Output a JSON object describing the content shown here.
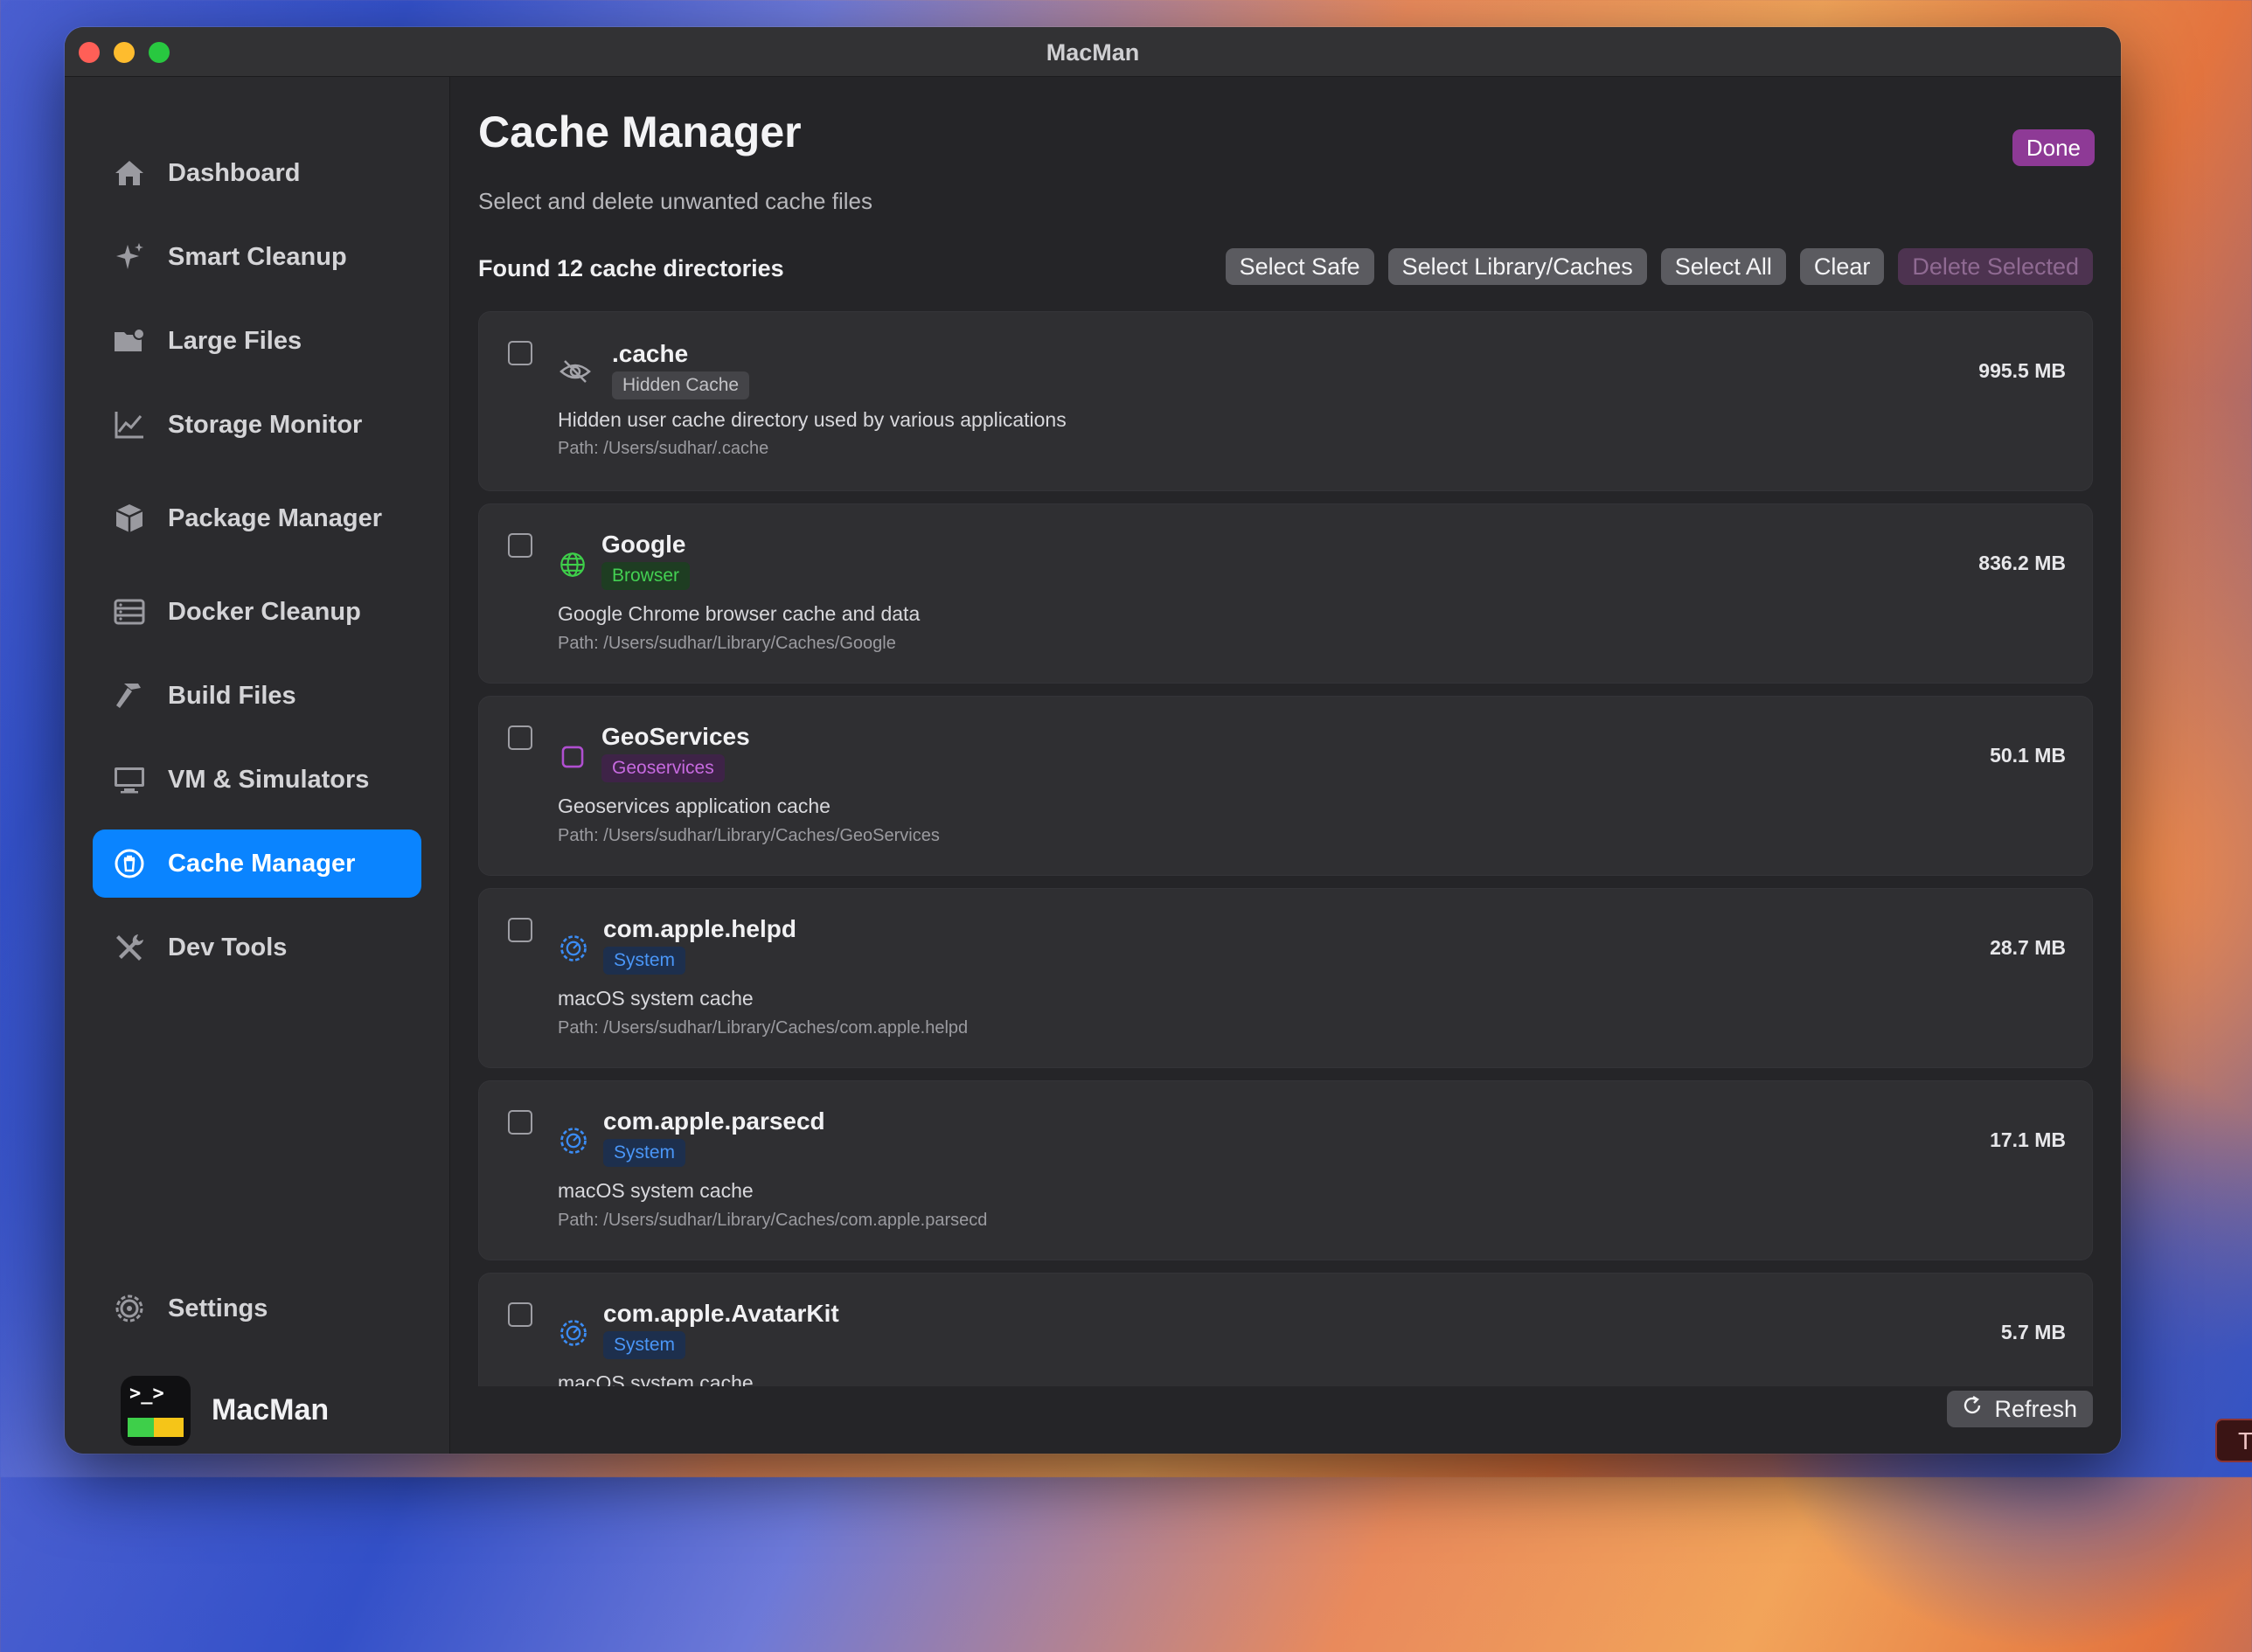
{
  "window": {
    "title": "MacMan"
  },
  "sidebar": {
    "items": [
      {
        "label": "Dashboard",
        "icon": "house-icon"
      },
      {
        "label": "Smart Cleanup",
        "icon": "sparkles-icon"
      },
      {
        "label": "Large Files",
        "icon": "folder-badge-icon"
      },
      {
        "label": "Storage Monitor",
        "icon": "line-chart-icon"
      },
      {
        "label": "Package Manager",
        "icon": "package-icon"
      },
      {
        "label": "Docker Cleanup",
        "icon": "server-rack-icon"
      },
      {
        "label": "Build Files",
        "icon": "hammer-icon"
      },
      {
        "label": "VM & Simulators",
        "icon": "monitor-icon"
      },
      {
        "label": "Cache Manager",
        "icon": "trash-circle-icon",
        "active": true
      },
      {
        "label": "Dev Tools",
        "icon": "tools-icon"
      }
    ],
    "settings_label": "Settings",
    "brand_name": "MacMan",
    "logo_prompt": ">_>"
  },
  "main": {
    "title": "Cache Manager",
    "subtitle": "Select and delete unwanted cache files",
    "done_label": "Done",
    "found_count": "Found 12 cache directories",
    "toolbar": {
      "select_safe": "Select Safe",
      "select_library": "Select Library/Caches",
      "select_all": "Select All",
      "clear": "Clear",
      "delete_selected": "Delete Selected"
    },
    "refresh_label": "Refresh"
  },
  "caches": [
    {
      "name": ".cache",
      "badge": "Hidden Cache",
      "description": "Hidden user cache directory used by various applications",
      "path": "Path: /Users/sudhar/.cache",
      "size": "995.5 MB",
      "icon": "eye-slash-icon",
      "checked": false
    },
    {
      "name": "Google",
      "badge": "Browser",
      "description": "Google Chrome browser cache and data",
      "path": "Path: /Users/sudhar/Library/Caches/Google",
      "size": "836.2 MB",
      "icon": "globe-icon",
      "checked": false
    },
    {
      "name": "GeoServices",
      "badge": "Geoservices",
      "description": "Geoservices application cache",
      "path": "Path: /Users/sudhar/Library/Caches/GeoServices",
      "size": "50.1 MB",
      "icon": "square-icon",
      "checked": false
    },
    {
      "name": "com.apple.helpd",
      "badge": "System",
      "description": "macOS system cache",
      "path": "Path: /Users/sudhar/Library/Caches/com.apple.helpd",
      "size": "28.7 MB",
      "icon": "gear-icon",
      "checked": false
    },
    {
      "name": "com.apple.parsecd",
      "badge": "System",
      "description": "macOS system cache",
      "path": "Path: /Users/sudhar/Library/Caches/com.apple.parsecd",
      "size": "17.1 MB",
      "icon": "gear-icon",
      "checked": false
    },
    {
      "name": "com.apple.AvatarKit",
      "badge": "System",
      "description": "macOS system cache",
      "path": "",
      "size": "5.7 MB",
      "icon": "gear-icon",
      "checked": false
    }
  ],
  "colors": {
    "accent": "#0a84ff",
    "done_button": "#8e3a96",
    "badge_hidden": "#4a4a4e",
    "badge_browser": "#1e3d22",
    "badge_geoservices": "#3e2347",
    "badge_system": "#1d2f4d"
  },
  "corner_tab_text": "T"
}
